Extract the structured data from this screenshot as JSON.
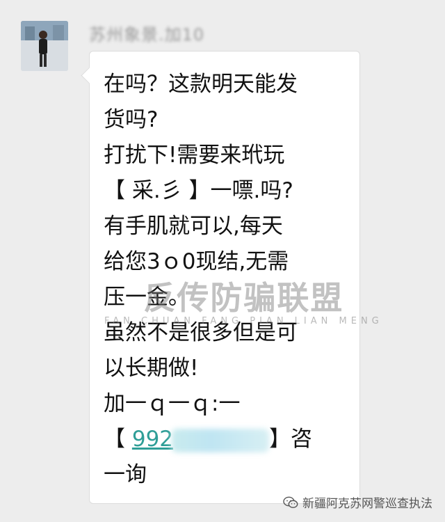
{
  "sender": {
    "name": "苏州象景.加10"
  },
  "message": {
    "lines": [
      "在吗？这款明天能发",
      "货吗?",
      "打扰下!需要来玳玩",
      "【 采.彡 】一嘌.吗?",
      "有手肌就可以,每天",
      "给您3ｏ0现结,无需",
      "压一金。",
      "虽然不是很多但是可",
      "以长期做!",
      "加一ｑ一ｑ:一"
    ],
    "contact_line": {
      "open_bracket": "【",
      "qq_visible": "992",
      "close_text": "】咨"
    },
    "last_line": "一询"
  },
  "watermark": {
    "main": "反传防骗联盟",
    "sub": "FAN CHUAN FANG PIAN LIAN MENG"
  },
  "footer": {
    "brand": "新疆阿克苏网警巡查执法",
    "icon": "wechat-icon"
  }
}
